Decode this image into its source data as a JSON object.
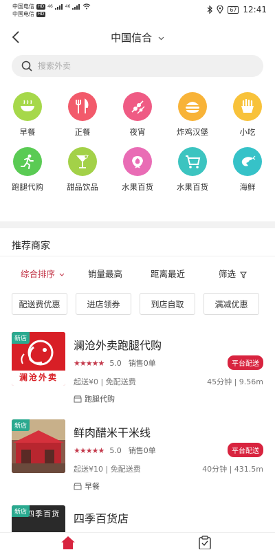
{
  "status_bar": {
    "carrier1": "中国电信",
    "carrier2": "中国电信",
    "hd": "HD",
    "signal": "46",
    "battery": "67",
    "time": "12:41"
  },
  "header": {
    "title": "中国信合",
    "back_icon": "chevron-left-icon",
    "caret_icon": "chevron-down-icon"
  },
  "search": {
    "placeholder": "搜索外卖",
    "icon": "search-icon"
  },
  "categories": [
    {
      "label": "早餐",
      "icon": "bowl-icon",
      "color": "#a6d84a"
    },
    {
      "label": "正餐",
      "icon": "utensils-icon",
      "color": "#f25a6b"
    },
    {
      "label": "夜宵",
      "icon": "skewer-icon",
      "color": "#ef5b84"
    },
    {
      "label": "炸鸡汉堡",
      "icon": "burger-icon",
      "color": "#f8b338"
    },
    {
      "label": "小吃",
      "icon": "snack-icon",
      "color": "#f8c23a"
    },
    {
      "label": "跑腿代购",
      "icon": "runner-icon",
      "color": "#5acb54"
    },
    {
      "label": "甜品饮品",
      "icon": "cocktail-icon",
      "color": "#a3d148"
    },
    {
      "label": "水果百货",
      "icon": "fruit-icon",
      "color": "#e96cb5"
    },
    {
      "label": "水果百货",
      "icon": "cart-icon",
      "color": "#3cc4c0"
    },
    {
      "label": "海鲜",
      "icon": "shrimp-icon",
      "color": "#36c2c8"
    }
  ],
  "section_title": "推荐商家",
  "sort": {
    "items": [
      "综合排序",
      "销量最高",
      "距离最近",
      "筛选"
    ],
    "active_color": "#c3384a"
  },
  "filters": [
    "配送费优惠",
    "进店领券",
    "到店自取",
    "满减优惠"
  ],
  "merchants": [
    {
      "new_label": "新店",
      "name": "澜沧外卖跑腿代购",
      "stars": "★★★★★",
      "rating": "5.0",
      "sales": "销售0单",
      "badge": "平台配送",
      "fee": "起送¥0 | 免配送费",
      "time": "45分钟 | 9.56m",
      "tag": "跑腿代购",
      "logo_text": "澜沧外卖"
    },
    {
      "new_label": "新店",
      "name": "鲜肉醋米干米线",
      "stars": "★★★★★",
      "rating": "5.0",
      "sales": "销售0单",
      "badge": "平台配送",
      "fee": "起送¥10 | 免配送费",
      "time": "40分钟 | 431.5m",
      "tag": "早餐"
    },
    {
      "new_label": "新店",
      "name": "四季百货店",
      "logo_text": "四季百货"
    }
  ],
  "colors": {
    "accent": "#c3384a",
    "badge": "#d8243f",
    "new_tag": "#2aa98f"
  }
}
